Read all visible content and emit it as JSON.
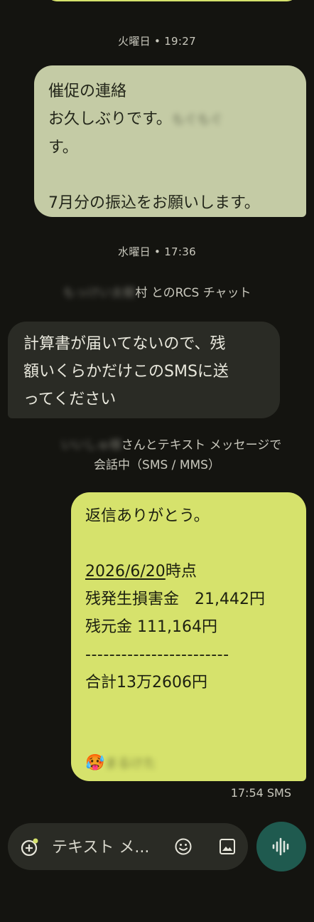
{
  "timestamps": {
    "tuesday": "火曜日 • 19:27",
    "wednesday": "水曜日 • 17:36"
  },
  "messages": {
    "old_incoming": {
      "line1": "催促の連絡",
      "line2": "お久しぶりです。",
      "line2_redacted": "もぐもぐ",
      "line3": "す。",
      "line4": "7月分の振込をお願いします。"
    },
    "rcs_notice": {
      "redacted": "もっけい太樹",
      "text": "村 とのRCS チャット"
    },
    "received": {
      "line1": "計算書が届いてないので、残",
      "line2": "額いくらかだけこのSMSに送",
      "line3": "ってください"
    },
    "sms_notice": {
      "redacted": "いいしゅ様",
      "line1": "さんとテキスト メッセージで",
      "line2": "会話中（SMS / MMS）"
    },
    "outgoing": {
      "line1": "返信ありがとう。",
      "date": "2026/6/20",
      "date_suffix": "時点",
      "line3": "残発生損害金　21,442円",
      "line4": "残元金 111,164円",
      "divider": "------------------------",
      "line6": "合計13万2606円",
      "emoji": "🥵",
      "signature_redacted": "まるけた"
    },
    "outgoing_meta": "17:54 SMS"
  },
  "composer": {
    "placeholder": "テキスト メ...",
    "add_icon": "add-circle-icon",
    "emoji_icon": "emoji-icon",
    "gallery_icon": "image-icon",
    "voice_icon": "voice-wave-icon"
  },
  "colors": {
    "background": "#141410",
    "outgoing_bubble": "#d6e26c",
    "old_bubble": "#c4cba5",
    "received_bubble": "#2a2b25",
    "voice_button": "#1f5a4f"
  }
}
